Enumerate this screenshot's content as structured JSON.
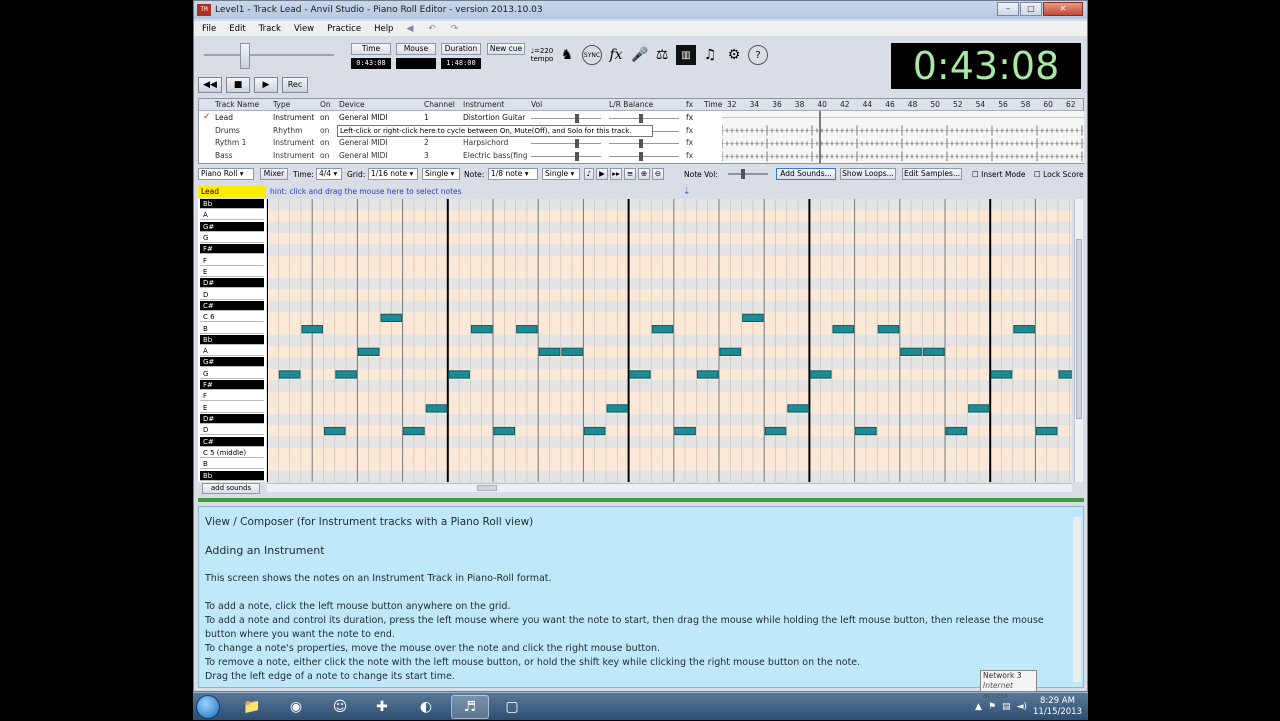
{
  "window": {
    "title": "Level1 - Track Lead - Anvil Studio - Piano Roll Editor - version 2013.10.03",
    "icon_text": "TM"
  },
  "menu": [
    "File",
    "Edit",
    "Track",
    "View",
    "Practice",
    "Help"
  ],
  "toolbar": {
    "time_label": "Time",
    "mouse_label": "Mouse",
    "duration_label": "Duration",
    "new_cue_label": "New cue",
    "time_value": "0:43:08",
    "mouse_value": "",
    "duration_value": "1:48:00",
    "tempo_label": "♩=220\ntempo",
    "sync_label": "SYNC",
    "fx_label": "fx",
    "clock": "0:43:08",
    "rec_label": "Rec"
  },
  "tracks": {
    "headers": [
      "Track Name",
      "Type",
      "On",
      "Device",
      "Channel",
      "Instrument",
      "Vol",
      "L/R Balance",
      "fx",
      "Time"
    ],
    "timeline": [
      "32",
      "34",
      "36",
      "38",
      "40",
      "42",
      "44",
      "46",
      "48",
      "50",
      "52",
      "54",
      "56",
      "58",
      "60",
      "62"
    ],
    "rows": [
      {
        "name": "Lead",
        "type": "Instrument",
        "on": "on",
        "device": "General MIDI",
        "channel": "1",
        "instrument": "Distortion Guitar",
        "fx": "fx",
        "selected": true
      },
      {
        "name": "Drums",
        "type": "Rhythm",
        "on": "on",
        "device": "",
        "channel": "",
        "instrument": "",
        "fx": "fx",
        "selected": false
      },
      {
        "name": "Rythm 1",
        "type": "Instrument",
        "on": "on",
        "device": "General MIDI",
        "channel": "2",
        "instrument": "Harpsichord",
        "fx": "fx",
        "selected": false
      },
      {
        "name": "Bass",
        "type": "Instrument",
        "on": "on",
        "device": "General MIDI",
        "channel": "3",
        "instrument": "Electric bass(finge",
        "fx": "fx",
        "selected": false
      }
    ],
    "tooltip": "Left-click or right-click here to cycle between On, Mute(Off), and Solo for this track."
  },
  "controls": {
    "view": "Piano Roll",
    "mixer": "Mixer",
    "time_label": "Time:",
    "time_sig": "4/4",
    "grid_label": "Grid:",
    "grid": "1/16 note",
    "grid_mode": "Single",
    "note_label": "Note:",
    "note": "1/8 note",
    "note_mode": "Single",
    "note_vol_label": "Note Vol:",
    "add_sounds": "Add Sounds...",
    "show_loops": "Show Loops...",
    "edit_samples": "Edit Samples...",
    "insert_mode": "Insert Mode",
    "lock_score": "Lock Score"
  },
  "piano_roll": {
    "track_label": "Lead",
    "hint": "hint:  click and drag the mouse here to select notes",
    "keys": [
      {
        "label": "Bb",
        "black": true
      },
      {
        "label": "A",
        "black": false
      },
      {
        "label": "G#",
        "black": true
      },
      {
        "label": "G",
        "black": false
      },
      {
        "label": "F#",
        "black": true
      },
      {
        "label": "F",
        "black": false
      },
      {
        "label": "E",
        "black": false
      },
      {
        "label": "D#",
        "black": true
      },
      {
        "label": "D",
        "black": false
      },
      {
        "label": "C#",
        "black": true
      },
      {
        "label": "C 6",
        "black": false
      },
      {
        "label": "B",
        "black": false
      },
      {
        "label": "Bb",
        "black": true
      },
      {
        "label": "A",
        "black": false
      },
      {
        "label": "G#",
        "black": true
      },
      {
        "label": "G",
        "black": false
      },
      {
        "label": "F#",
        "black": true
      },
      {
        "label": "F",
        "black": false
      },
      {
        "label": "E",
        "black": false
      },
      {
        "label": "D#",
        "black": true
      },
      {
        "label": "D",
        "black": false
      },
      {
        "label": "C#",
        "black": true
      },
      {
        "label": "C 5 (middle)",
        "black": false
      },
      {
        "label": "B",
        "black": false
      },
      {
        "label": "Bb",
        "black": true
      }
    ],
    "add_sounds_button": "add sounds",
    "note_color": "#1d8a96"
  },
  "help": {
    "title": "View / Composer (for Instrument tracks with a Piano Roll view)",
    "subtitle": "Adding an Instrument",
    "intro": "This screen shows the notes on an Instrument Track in Piano-Roll format.",
    "lines": [
      "To add a note, click the left mouse button anywhere on the grid.",
      "To add a note and control its duration, press the left mouse where you want the note to start, then drag the mouse while holding the left mouse button, then release the mouse button where you want the note to end.",
      "To change a note's properties, move the mouse over the note and click the right mouse button.",
      "To remove a note, either click the note with the left mouse button, or hold the shift key while clicking the right mouse button on the note.",
      "Drag the left edge of a note to change its start time."
    ]
  },
  "taskbar": {
    "time": "8:29 AM",
    "date": "11/15/2013",
    "network_title": "Network  3",
    "network_sub": "Internet access"
  }
}
